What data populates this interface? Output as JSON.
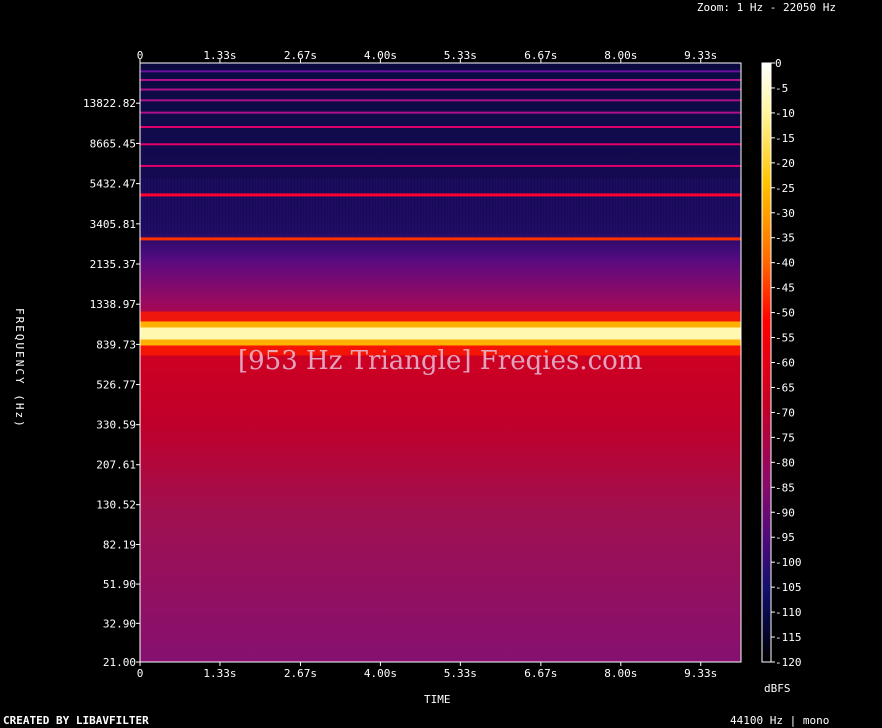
{
  "header": {
    "zoom_text": "Zoom: 1 Hz - 22050 Hz"
  },
  "footer": {
    "created_by": "CREATED BY LIBAVFILTER",
    "sample_info": "44100 Hz | mono"
  },
  "watermark": "[953 Hz Triangle] Freqies.com",
  "chart_data": {
    "type": "heatmap",
    "title": "",
    "xlabel": "TIME",
    "ylabel": "FREQUENCY (Hz)",
    "x_ticks": [
      "0",
      "1.33s",
      "2.67s",
      "4.00s",
      "5.33s",
      "6.67s",
      "8.00s",
      "9.33s"
    ],
    "x_tick_values_s": [
      0,
      1.33,
      2.67,
      4.0,
      5.33,
      6.67,
      8.0,
      9.33
    ],
    "xlim_s": [
      0,
      10.0
    ],
    "y_ticks": [
      "21.00",
      "32.90",
      "51.90",
      "82.19",
      "130.52",
      "207.61",
      "330.59",
      "526.77",
      "839.73",
      "1338.97",
      "2135.37",
      "3405.81",
      "5432.47",
      "8665.45",
      "13822.82"
    ],
    "y_scale": "log",
    "ylim_hz": [
      21,
      22050
    ],
    "colorbar": {
      "label": "dBFS",
      "ticks": [
        "0",
        "-5",
        "-10",
        "-15",
        "-20",
        "-25",
        "-30",
        "-35",
        "-40",
        "-45",
        "-50",
        "-55",
        "-60",
        "-65",
        "-70",
        "-75",
        "-80",
        "-85",
        "-90",
        "-95",
        "-100",
        "-105",
        "-110",
        "-115",
        "-120"
      ],
      "range_db": [
        -120,
        0
      ]
    },
    "harmonics": [
      {
        "freq_hz": 953,
        "level_db": 0
      },
      {
        "freq_hz": 2859,
        "level_db": -35
      },
      {
        "freq_hz": 4765,
        "level_db": -45
      },
      {
        "freq_hz": 6671,
        "level_db": -55
      },
      {
        "freq_hz": 8577,
        "level_db": -60
      },
      {
        "freq_hz": 10483,
        "level_db": -65
      },
      {
        "freq_hz": 12389,
        "level_db": -70
      },
      {
        "freq_hz": 14295,
        "level_db": -75
      },
      {
        "freq_hz": 16201,
        "level_db": -78
      },
      {
        "freq_hz": 18107,
        "level_db": -80
      },
      {
        "freq_hz": 20013,
        "level_db": -85
      }
    ],
    "background_db": -72
  }
}
